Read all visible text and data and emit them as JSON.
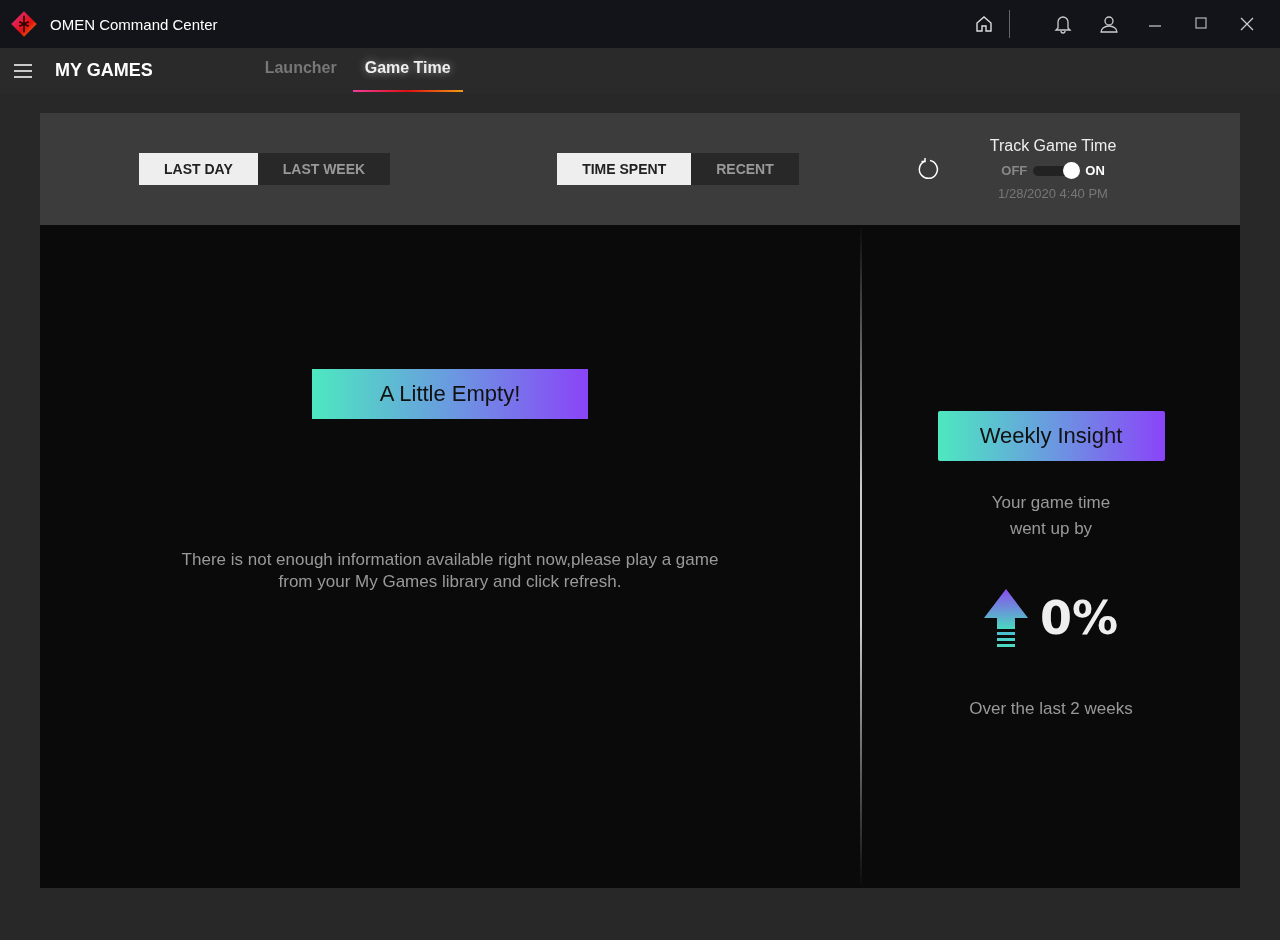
{
  "window": {
    "title": "OMEN Command Center"
  },
  "nav": {
    "title": "MY GAMES",
    "tabs": [
      {
        "label": "Launcher",
        "selected": false
      },
      {
        "label": "Game Time",
        "selected": true
      }
    ]
  },
  "filters": {
    "period_tabs": [
      {
        "label": "LAST DAY",
        "selected": true
      },
      {
        "label": "LAST WEEK",
        "selected": false
      }
    ],
    "metric_tabs": [
      {
        "label": "TIME SPENT",
        "selected": true
      },
      {
        "label": "RECENT",
        "selected": false
      }
    ],
    "track": {
      "label": "Track Game Time",
      "off_label": "OFF",
      "on_label": "ON",
      "on": true,
      "timestamp": "1/28/2020 4:40 PM"
    }
  },
  "empty_state": {
    "badge": "A Little Empty!",
    "message": "There is not enough information available right now,please play a game from your My Games library and click refresh."
  },
  "insight": {
    "badge": "Weekly Insight",
    "lines": [
      "Your game time",
      "went up by"
    ],
    "value": "0%",
    "footer": "Over the last 2 weeks"
  }
}
